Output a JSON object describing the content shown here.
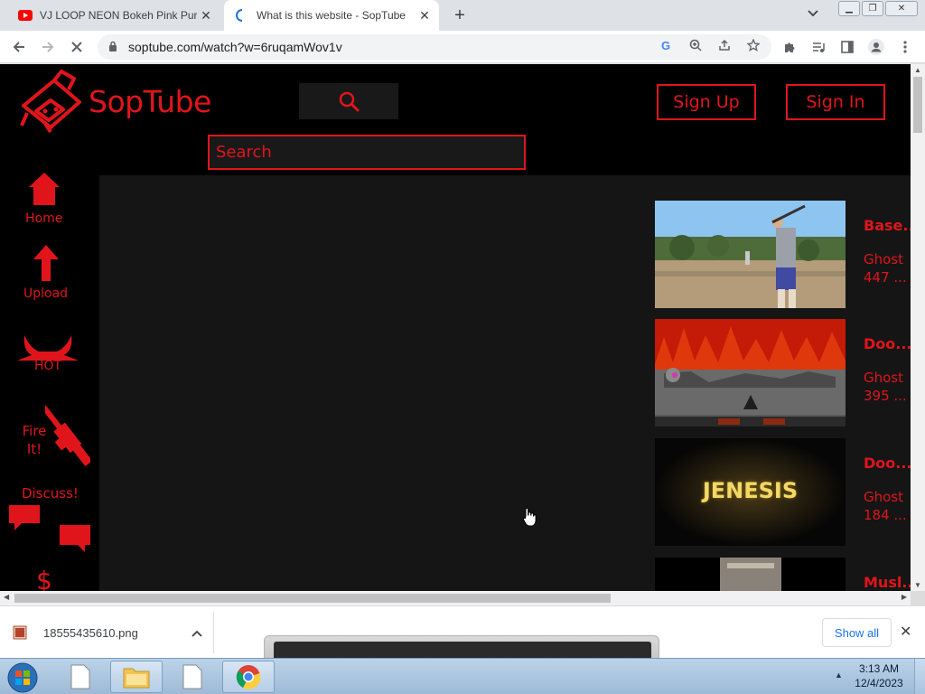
{
  "browser": {
    "tabs": [
      {
        "title": "VJ LOOP NEON Bokeh Pink Purpl",
        "favicon": "youtube-icon",
        "active": false
      },
      {
        "title": "What is this website - SopTube",
        "favicon": "loading-spinner-icon",
        "active": true
      }
    ],
    "url": "soptube.com/watch?w=6ruqamWov1v"
  },
  "site": {
    "logo_text": "SopTube",
    "search_placeholder": "Search",
    "signup_label": "Sign Up",
    "signin_label": "Sign In",
    "accent_color": "#e0151b",
    "nav": [
      {
        "label": "Home",
        "icon": "home-icon"
      },
      {
        "label": "Upload",
        "icon": "upload-arrow-icon"
      },
      {
        "label": "HOT",
        "icon": "devil-horns-icon"
      },
      {
        "label": "Fire It!",
        "icon": "rifle-icon"
      },
      {
        "label": "Discuss!",
        "icon": "chat-bubbles-icon"
      },
      {
        "label": "",
        "icon": "dollar-icon"
      }
    ],
    "recommendations": [
      {
        "title": "Base...",
        "channel": "Ghost",
        "views": "447 ..."
      },
      {
        "title": "Doo...",
        "channel": "Ghost",
        "views": "395 ..."
      },
      {
        "title": "Doo...",
        "channel": "Ghost",
        "views": "184 ...",
        "thumb_text": "JENESIS"
      },
      {
        "title": "Musl...",
        "channel": "",
        "views": ""
      }
    ]
  },
  "downloads": {
    "file_name": "18555435610.png",
    "show_all": "Show all"
  },
  "taskbar": {
    "time": "3:13 AM",
    "date": "12/4/2023"
  }
}
